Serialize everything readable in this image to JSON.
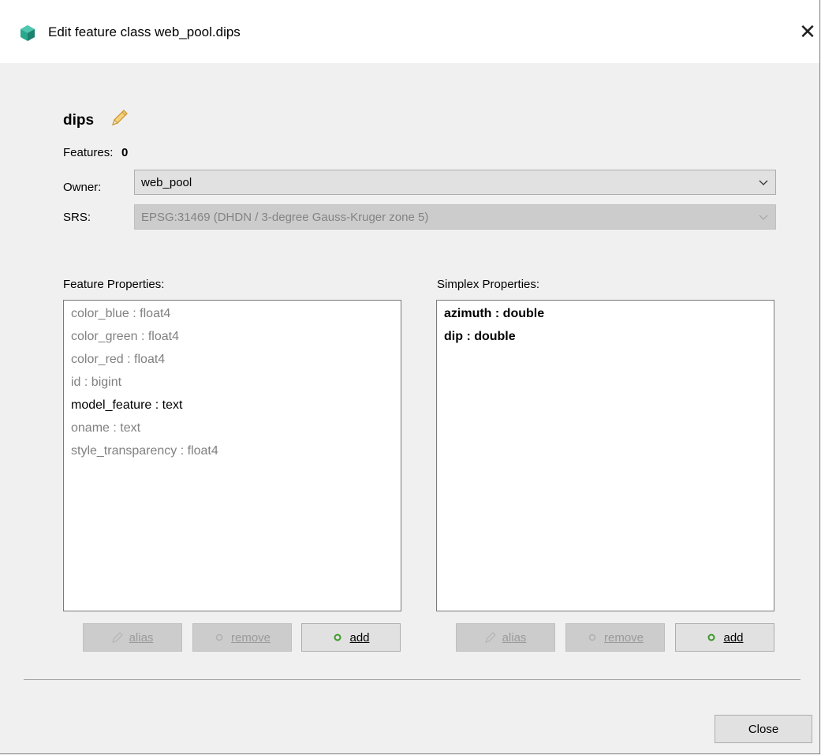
{
  "window": {
    "title": "Edit feature class web_pool.dips",
    "close_symbol": "✕"
  },
  "header": {
    "class_name": "dips"
  },
  "features": {
    "label": "Features:",
    "count": "0"
  },
  "owner": {
    "label": "Owner:",
    "value": "web_pool"
  },
  "srs": {
    "label": "SRS:",
    "value": "EPSG:31469 (DHDN / 3-degree Gauss-Kruger zone 5)"
  },
  "feature_properties": {
    "label": "Feature Properties:",
    "items": [
      {
        "text": "color_blue : float4",
        "state": "inactive"
      },
      {
        "text": "color_green : float4",
        "state": "inactive"
      },
      {
        "text": "color_red : float4",
        "state": "inactive"
      },
      {
        "text": "id : bigint",
        "state": "inactive"
      },
      {
        "text": "model_feature : text",
        "state": "active"
      },
      {
        "text": "oname : text",
        "state": "inactive"
      },
      {
        "text": "style_transparency : float4",
        "state": "inactive"
      }
    ],
    "buttons": {
      "alias": "alias",
      "remove": "remove",
      "add": "add"
    }
  },
  "simplex_properties": {
    "label": "Simplex Properties:",
    "items": [
      {
        "text": "azimuth : double",
        "state": "active"
      },
      {
        "text": "dip : double",
        "state": "active"
      }
    ],
    "buttons": {
      "alias": "alias",
      "remove": "remove",
      "add": "add"
    }
  },
  "footer": {
    "close_label": "Close"
  },
  "colors": {
    "add_icon": "#3c9a2a",
    "pencil": "#e9b64a",
    "app_icon": "#29a88e"
  }
}
